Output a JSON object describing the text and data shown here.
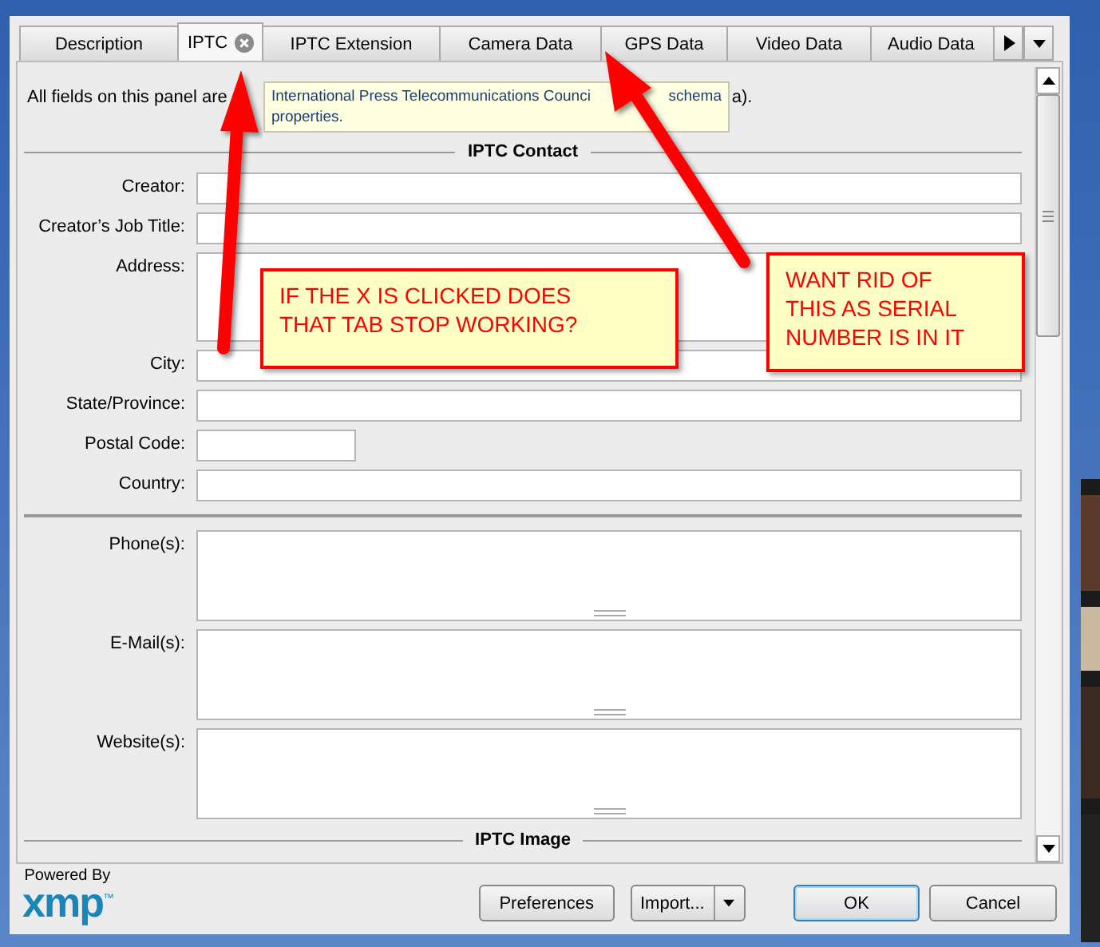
{
  "tabs": [
    {
      "label": "Description",
      "selected": false,
      "closable": false
    },
    {
      "label": "IPTC",
      "selected": true,
      "closable": true
    },
    {
      "label": "IPTC Extension",
      "selected": false,
      "closable": false
    },
    {
      "label": "Camera Data",
      "selected": false,
      "closable": false
    },
    {
      "label": "GPS Data",
      "selected": false,
      "closable": false
    },
    {
      "label": "Video Data",
      "selected": false,
      "closable": false
    },
    {
      "label": "Audio Data",
      "selected": false,
      "closable": false
    }
  ],
  "intro": {
    "start": "All fields on this panel are",
    "end": "a)."
  },
  "tooltip": {
    "line_1_start": "International Press Telecommunications Counci",
    "line_1_end": "schema",
    "line_2": "properties."
  },
  "sections": [
    {
      "heading": "IPTC Contact",
      "fields": [
        {
          "label": "Creator:",
          "kind": "line"
        },
        {
          "label": "Creator’s Job Title:",
          "kind": "line"
        },
        {
          "label": "Address:",
          "kind": "area"
        },
        {
          "label": "City:",
          "kind": "line"
        },
        {
          "label": "State/Province:",
          "kind": "line"
        },
        {
          "label": "Postal Code:",
          "kind": "short"
        },
        {
          "label": "Country:",
          "kind": "line"
        }
      ]
    },
    {
      "fields": [
        {
          "label": "Phone(s):",
          "kind": "grip"
        },
        {
          "label": "E-Mail(s):",
          "kind": "grip"
        },
        {
          "label": "Website(s):",
          "kind": "grip"
        }
      ]
    },
    {
      "heading": "IPTC Image"
    }
  ],
  "logo": {
    "caption": "Powered By",
    "mark": "xmp",
    "trademark": "™"
  },
  "buttons": [
    {
      "label": "Preferences",
      "kind": "plain"
    },
    {
      "label": "Import...",
      "kind": "split"
    },
    {
      "label": "OK",
      "kind": "default"
    },
    {
      "label": "Cancel",
      "kind": "plain"
    }
  ],
  "callouts": [
    {
      "lines": [
        "IF THE X IS CLICKED DOES",
        "THAT TAB STOP WORKING?"
      ]
    },
    {
      "lines": [
        "WANT RID OF",
        "THIS AS SERIAL",
        "NUMBER IS IN IT"
      ]
    }
  ]
}
